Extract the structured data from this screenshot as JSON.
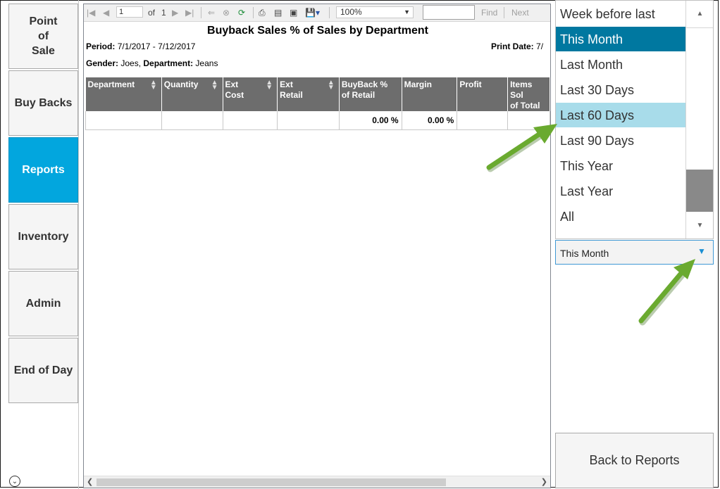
{
  "nav": {
    "items": [
      {
        "label": "Point\nof\nSale",
        "active": false
      },
      {
        "label": "Buy Backs",
        "active": false
      },
      {
        "label": "Reports",
        "active": true
      },
      {
        "label": "Inventory",
        "active": false
      },
      {
        "label": "Admin",
        "active": false
      },
      {
        "label": "End of Day",
        "active": false
      }
    ]
  },
  "toolbar": {
    "page_current": "1",
    "of_label": "of",
    "page_total": "1",
    "zoom": "100%",
    "find_label": "Find",
    "next_label": "Next"
  },
  "report": {
    "title": "Buyback Sales % of Sales by Department",
    "period_label": "Period:",
    "period_value": "7/1/2017 - 7/12/2017",
    "print_date_label": "Print Date:",
    "print_date_value": "7/",
    "gender_label": "Gender:",
    "gender_value": "Joes,",
    "department_label": "Department:",
    "department_value": "Jeans",
    "columns": [
      "Department",
      "Quantity",
      "Ext\nCost",
      "Ext\nRetail",
      "BuyBack %\nof Retail",
      "Margin",
      "Profit",
      "Items Sol\nof Total"
    ],
    "row": [
      "",
      "",
      "",
      "",
      "0.00 %",
      "0.00 %",
      "",
      ""
    ]
  },
  "date_range": {
    "options": [
      "Week before last",
      "This Month",
      "Last Month",
      "Last 30 Days",
      "Last 60 Days",
      "Last 90 Days",
      "This Year",
      "Last Year",
      "All"
    ],
    "selected": "This Month",
    "highlighted": "Last 60 Days"
  },
  "back_label": "Back to Reports",
  "colors": {
    "accent_blue": "#02a6de",
    "selected_item": "#0078a0",
    "hover_item": "#a8dcea",
    "annotation_arrow": "#6aaa2f"
  }
}
